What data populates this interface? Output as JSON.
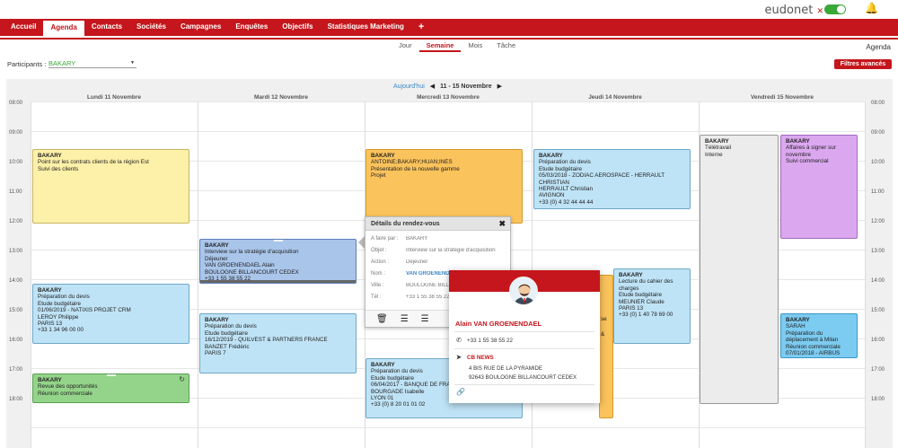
{
  "header": {
    "brand": "eudonet",
    "brand_mark": "✕"
  },
  "nav": {
    "items": [
      "Accueil",
      "Agenda",
      "Contacts",
      "Sociétés",
      "Campagnes",
      "Enquêtes",
      "Objectifs",
      "Statistiques Marketing"
    ],
    "active": "Agenda",
    "plus": "+"
  },
  "views": {
    "tabs": [
      "Jour",
      "Semaine",
      "Mois",
      "Tâche"
    ],
    "active": "Semaine",
    "page_label": "Agenda"
  },
  "participants": {
    "label": "Participants :",
    "value": "BAKARY"
  },
  "filters_button": "Filtres avancés",
  "week_nav": {
    "today": "Aujourd'hui",
    "range": "11 - 15 Novembre"
  },
  "days": [
    "Lundi 11 Novembre",
    "Mardi 12 Novembre",
    "Mercredi 13 Novembre",
    "Jeudi 14 Novembre",
    "Vendredi 15 Novembre"
  ],
  "hours": [
    "08:00",
    "09:00",
    "10:00",
    "11:00",
    "12:00",
    "13:00",
    "14:00",
    "15:00",
    "16:00",
    "17:00",
    "18:00"
  ],
  "events": {
    "mon1": {
      "who": "BAKARY",
      "lines": [
        "Point sur les contrats clients de la région Est",
        "Suivi des clients"
      ]
    },
    "mon2": {
      "who": "BAKARY",
      "lines": [
        "Préparation du devis",
        "Etude budgétaire",
        "01/06/2019 - NATIXIS PROJET CRM",
        "LEROY Philippe",
        "PARIS 13",
        "+33 1 34 96 00 00"
      ]
    },
    "mon3": {
      "who": "BAKARY",
      "lines": [
        "Revue des opportunités",
        "Réunion commerciale"
      ]
    },
    "tue1": {
      "who": "BAKARY",
      "lines": [
        "Interview sur la stratégie d'acquisition",
        "Déjeuner",
        "VAN GROENENDAEL Alain",
        "BOULOGNE BILLANCOURT CEDEX",
        "+33 1 55 38 55 22"
      ]
    },
    "tue2": {
      "who": "BAKARY",
      "lines": [
        "Préparation du devis",
        "Etude budgétaire",
        "16/12/2019 - QUILVEST & PARTNERS FRANCE",
        "BANZET Frédéric",
        "PARIS 7"
      ]
    },
    "wed1": {
      "who": "BAKARY",
      "lines": [
        "ANTOINE;BAKARY;HUAN;INES",
        "Présentation de la nouvelle gamme",
        "Projet"
      ]
    },
    "wed2": {
      "who": "BAKARY",
      "lines": [
        "Préparation du devis",
        "Etude budgétaire",
        "06/04/2017 - BANQUE DE FRANCE",
        "BOURGADE Isabelle",
        "LYON 01",
        "+33 (0) 8 20 01 01 02"
      ]
    },
    "thu1": {
      "who": "BAKARY",
      "lines": [
        "Préparation du devis",
        "Etude budgétaire",
        "05/03/2018 - ZODIAC AEROSPACE - HERRAULT",
        "CHRISTIAN",
        "HERRAULT Christian",
        "AVIGNON",
        "+33 (0) 4 32 44 44 44"
      ]
    },
    "thu2": {
      "who": "BAKARY",
      "lines": [
        "Lecture du cahier des",
        "charges",
        "Etude budgétaire",
        "MEUNIER Claude",
        "PARIS 13",
        "+33 (0) 1 40 78 69 00"
      ]
    },
    "fri1": {
      "who": "BAKARY",
      "lines": [
        "Télétravail",
        "Interne"
      ]
    },
    "fri2": {
      "who": "BAKARY",
      "lines": [
        "Affaires à signer sur",
        "novembre",
        "Suivi commercial"
      ]
    },
    "fri3": {
      "who": "BAKARY",
      "lines": [
        "SARAH",
        "Préparation du",
        "déplacement à Milan",
        "Réunion commerciale",
        "07/01/2018 - AIRBUS"
      ]
    },
    "wed_mid": {
      "lines": [
        "se",
        "&"
      ]
    }
  },
  "details": {
    "title": "Détails du rendez-vous",
    "rows": [
      {
        "label": "A faire par :",
        "value": "BAKARY"
      },
      {
        "label": "Objet :",
        "value": "Interview sur la stratégie d'acquisition"
      },
      {
        "label": "Action :",
        "value": "Déjeuner"
      },
      {
        "label": "Nom :",
        "value": "VAN GROENENDAEL Alain"
      },
      {
        "label": "Ville :",
        "value": "BOULOGNE BILLANCOURT CEDEX"
      },
      {
        "label": "Tél :",
        "value": "+33 1 55 38 55 22"
      }
    ]
  },
  "contact_card": {
    "name": "Alain VAN GROENENDAEL",
    "phone": "+33 1 55 38 55 22",
    "company": "CB NEWS",
    "address1": "4 BIS RUE DE LA PYRAMIDE",
    "address2": "92643 BOULOGNE BILLANCOURT CEDEX"
  },
  "colors": {
    "brand_red": "#c4161c",
    "toggle_green": "#3aa839",
    "link_blue": "#3a86c8"
  }
}
